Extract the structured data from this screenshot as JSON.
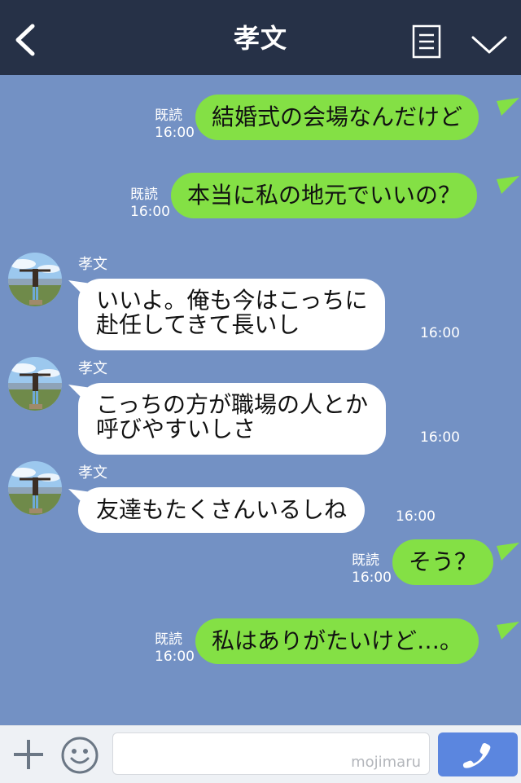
{
  "header": {
    "title": "孝文",
    "back_icon": "chevron-left-icon",
    "menu_icon": "menu-list-icon",
    "collapse_icon": "chevron-down-icon"
  },
  "colors": {
    "header_bg": "#263147",
    "chat_bg": "#7391c4",
    "outgoing_bubble": "#84e045",
    "incoming_bubble": "#ffffff",
    "call_button": "#5b86df"
  },
  "messages": [
    {
      "direction": "out",
      "text": "結婚式の会場なんだけど",
      "read": "既読",
      "time": "16:00"
    },
    {
      "direction": "out",
      "text": "本当に私の地元でいいの？",
      "read": "既読",
      "time": "16:00"
    },
    {
      "direction": "in",
      "sender": "孝文",
      "lines": [
        "いいよ。俺も今はこっちに",
        "赴任してきて長いし"
      ],
      "time": "16:00"
    },
    {
      "direction": "in",
      "sender": "孝文",
      "lines": [
        "こっちの方が職場の人とか",
        "呼びやすいしさ"
      ],
      "time": "16:00"
    },
    {
      "direction": "in",
      "sender": "孝文",
      "text": "友達もたくさんいるしね",
      "time": "16:00"
    },
    {
      "direction": "out",
      "text": "そう？",
      "read": "既読",
      "time": "16:00"
    },
    {
      "direction": "out",
      "text": "私はありがたいけど…。",
      "read": "既読",
      "time": "16:00"
    }
  ],
  "bottom_bar": {
    "plus_icon": "plus-icon",
    "emoji_icon": "smiley-icon",
    "input_value": "",
    "watermark": "mojimaru",
    "call_icon": "phone-icon"
  }
}
